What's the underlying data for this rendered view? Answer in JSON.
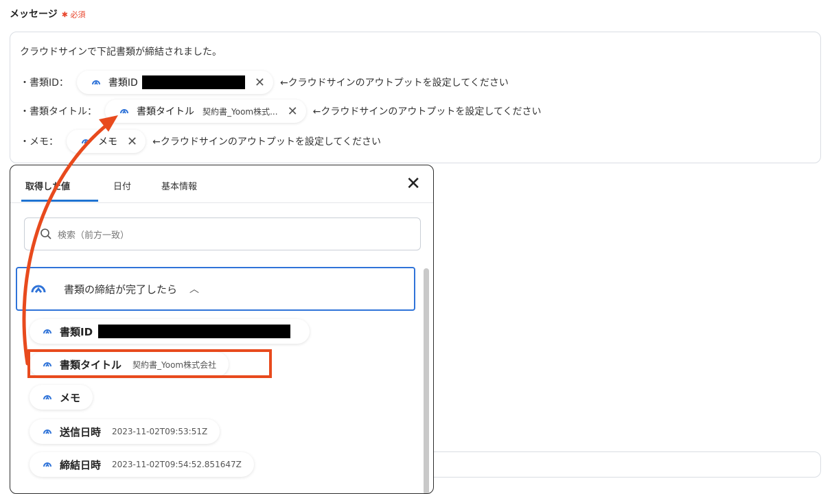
{
  "field": {
    "label": "メッセージ",
    "required": "✱ 必須"
  },
  "message": {
    "line1": "クラウドサインで下記書類が締結されました。",
    "line2_prefix": "・書類ID：",
    "line3_prefix": "・書類タイトル：",
    "line4_prefix": "・メモ：",
    "chip_id_label": "書類ID",
    "chip_title_label": "書類タイトル",
    "chip_title_value": "契約書_Yoom株式...",
    "chip_memo_label": "メモ",
    "hint": "←クラウドサインのアウトプットを設定してください",
    "close_glyph": "✕"
  },
  "panel": {
    "tabs": [
      "取得した値",
      "日付",
      "基本情報"
    ],
    "close_glyph": "✕",
    "search_placeholder": "検索（前方一致）",
    "section_title": "書類の締結が完了したら",
    "section_caret": "︿",
    "items": [
      {
        "label": "書類ID",
        "value": ""
      },
      {
        "label": "書類タイトル",
        "value": "契約書_Yoom株式会社"
      },
      {
        "label": "メモ",
        "value": ""
      },
      {
        "label": "送信日時",
        "value": "2023-11-02T09:53:51Z"
      },
      {
        "label": "締結日時",
        "value": "2023-11-02T09:54:52.851647Z"
      }
    ]
  },
  "colors": {
    "accent": "#1f73d1",
    "highlight": "#e84a1d",
    "required": "#e8452c"
  },
  "icons": [
    "cloudsign-icon",
    "search-icon",
    "close-icon",
    "chevron-up-icon"
  ]
}
